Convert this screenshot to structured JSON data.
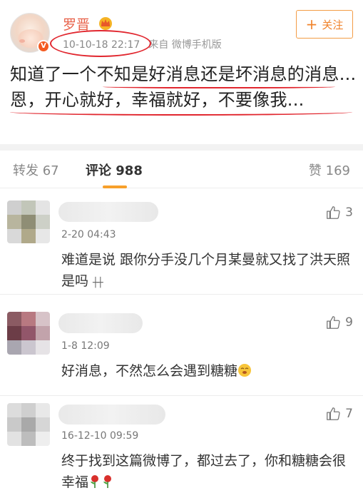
{
  "post": {
    "username": "罗晋",
    "time": "10-10-18 22:17",
    "source": "来自 微博手机版",
    "follow_label": "关注",
    "text": "知道了一个不知是好消息还是坏消息的消息...恩，开心就好，幸福就好，不要像我..."
  },
  "tabs": {
    "repost": "转发 67",
    "comment": "评论 988",
    "like": "赞 169"
  },
  "comments": [
    {
      "time": "2-20 04:43",
      "text": "难道是说 跟你分手没几个月某曼就又找了洪天照是吗",
      "likes": "3"
    },
    {
      "time": "1-8 12:09",
      "text": "好消息，不然怎么会遇到糖糖",
      "likes": "9"
    },
    {
      "time": "16-12-10 09:59",
      "text": "终于找到这篇微博了，都过去了，你和糖糖会很幸福",
      "likes": "7"
    }
  ],
  "icons": {
    "verified": "verified-badge-icon",
    "crown": "crown-icon",
    "like": "thumbs-up-icon",
    "rose": "rose-icon",
    "emoji": "face-emoji-icon"
  },
  "colors": {
    "username": "#e8624a",
    "accent": "#f0832b",
    "annotation": "#e1262e",
    "tab_indicator": "#f7a02a"
  }
}
